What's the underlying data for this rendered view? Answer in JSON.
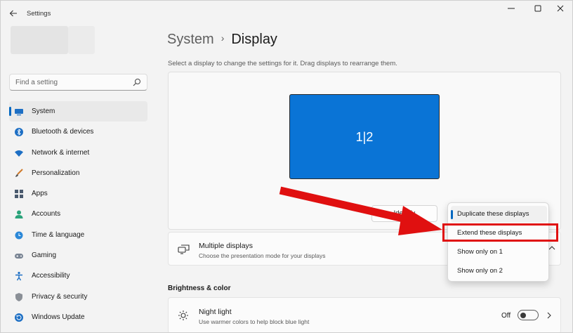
{
  "window": {
    "title": "Settings",
    "back_icon": "arrow-left-icon",
    "controls": {
      "minimize": "—",
      "maximize": "☐",
      "close": "✕"
    }
  },
  "search": {
    "placeholder": "Find a setting",
    "icon": "search-icon"
  },
  "sidebar": {
    "items": [
      {
        "label": "System",
        "icon": "system-icon",
        "active": true
      },
      {
        "label": "Bluetooth & devices",
        "icon": "bluetooth-icon"
      },
      {
        "label": "Network & internet",
        "icon": "wifi-icon"
      },
      {
        "label": "Personalization",
        "icon": "brush-icon"
      },
      {
        "label": "Apps",
        "icon": "apps-icon"
      },
      {
        "label": "Accounts",
        "icon": "person-icon"
      },
      {
        "label": "Time & language",
        "icon": "globe-clock-icon"
      },
      {
        "label": "Gaming",
        "icon": "gamepad-icon"
      },
      {
        "label": "Accessibility",
        "icon": "accessibility-icon"
      },
      {
        "label": "Privacy & security",
        "icon": "shield-icon"
      },
      {
        "label": "Windows Update",
        "icon": "update-icon"
      }
    ]
  },
  "breadcrumb": {
    "parent": "System",
    "separator": "›",
    "current": "Display"
  },
  "main": {
    "description": "Select a display to change the settings for it. Drag displays to rearrange them.",
    "monitor_label": "1|2",
    "identify_label": "Identify",
    "multiple_displays": {
      "title": "Multiple displays",
      "subtitle": "Choose the presentation mode for your displays"
    },
    "brightness_heading": "Brightness & color",
    "night_light": {
      "title": "Night light",
      "subtitle": "Use warmer colors to help block blue light",
      "state": "Off"
    }
  },
  "dropdown": {
    "options": [
      "Duplicate these displays",
      "Extend these displays",
      "Show only on 1",
      "Show only on 2"
    ],
    "selected_index": 0,
    "highlighted_index": 1
  },
  "colors": {
    "accent": "#0067c0",
    "monitor": "#0a74d6",
    "annotation_red": "#e01010"
  }
}
